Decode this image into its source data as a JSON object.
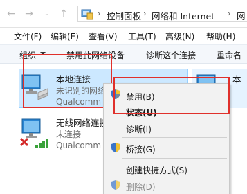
{
  "address_bar": {
    "crumbs": [
      "控制面板",
      "网络和 Internet",
      "网"
    ],
    "separator": "›"
  },
  "menu": {
    "items": [
      "文件(F)",
      "编辑(E)",
      "查看(V)",
      "工具(T)",
      "高级(N)",
      "帮助(H)"
    ]
  },
  "command_bar": {
    "organize": "组织",
    "items": [
      "禁用此网络设备",
      "诊断这个连接",
      "重命名"
    ]
  },
  "adapters": [
    {
      "name": "本地连接",
      "status": "未识别的网络",
      "device": "Qualcomm"
    },
    {
      "name": "无线网络连接",
      "status": "未连接",
      "device": "Qualcomm"
    },
    {
      "name": "本",
      "status": "",
      "device": ""
    }
  ],
  "context_menu": {
    "items": [
      {
        "label": "禁用(B)",
        "shield": true,
        "bold": false,
        "disabled": false
      },
      {
        "label": "状态(U)",
        "shield": false,
        "bold": true,
        "disabled": false
      },
      {
        "label": "诊断(I)",
        "shield": false,
        "bold": false,
        "disabled": false
      },
      {
        "label": "桥接(G)",
        "shield": true,
        "bold": false,
        "disabled": false
      },
      {
        "label": "创建快捷方式(S)",
        "shield": false,
        "bold": false,
        "disabled": false
      },
      {
        "label": "删除(D)",
        "shield": true,
        "bold": false,
        "disabled": true
      }
    ]
  },
  "colors": {
    "highlight": "#e0302b",
    "selection": "#cce8ff",
    "command_bar": "#f4f7fb"
  },
  "icons": [
    "back-icon",
    "forward-icon",
    "control-panel-icon",
    "network-adapter-icon",
    "disconnected-x-icon",
    "signal-bars-icon",
    "uac-shield-icon"
  ]
}
